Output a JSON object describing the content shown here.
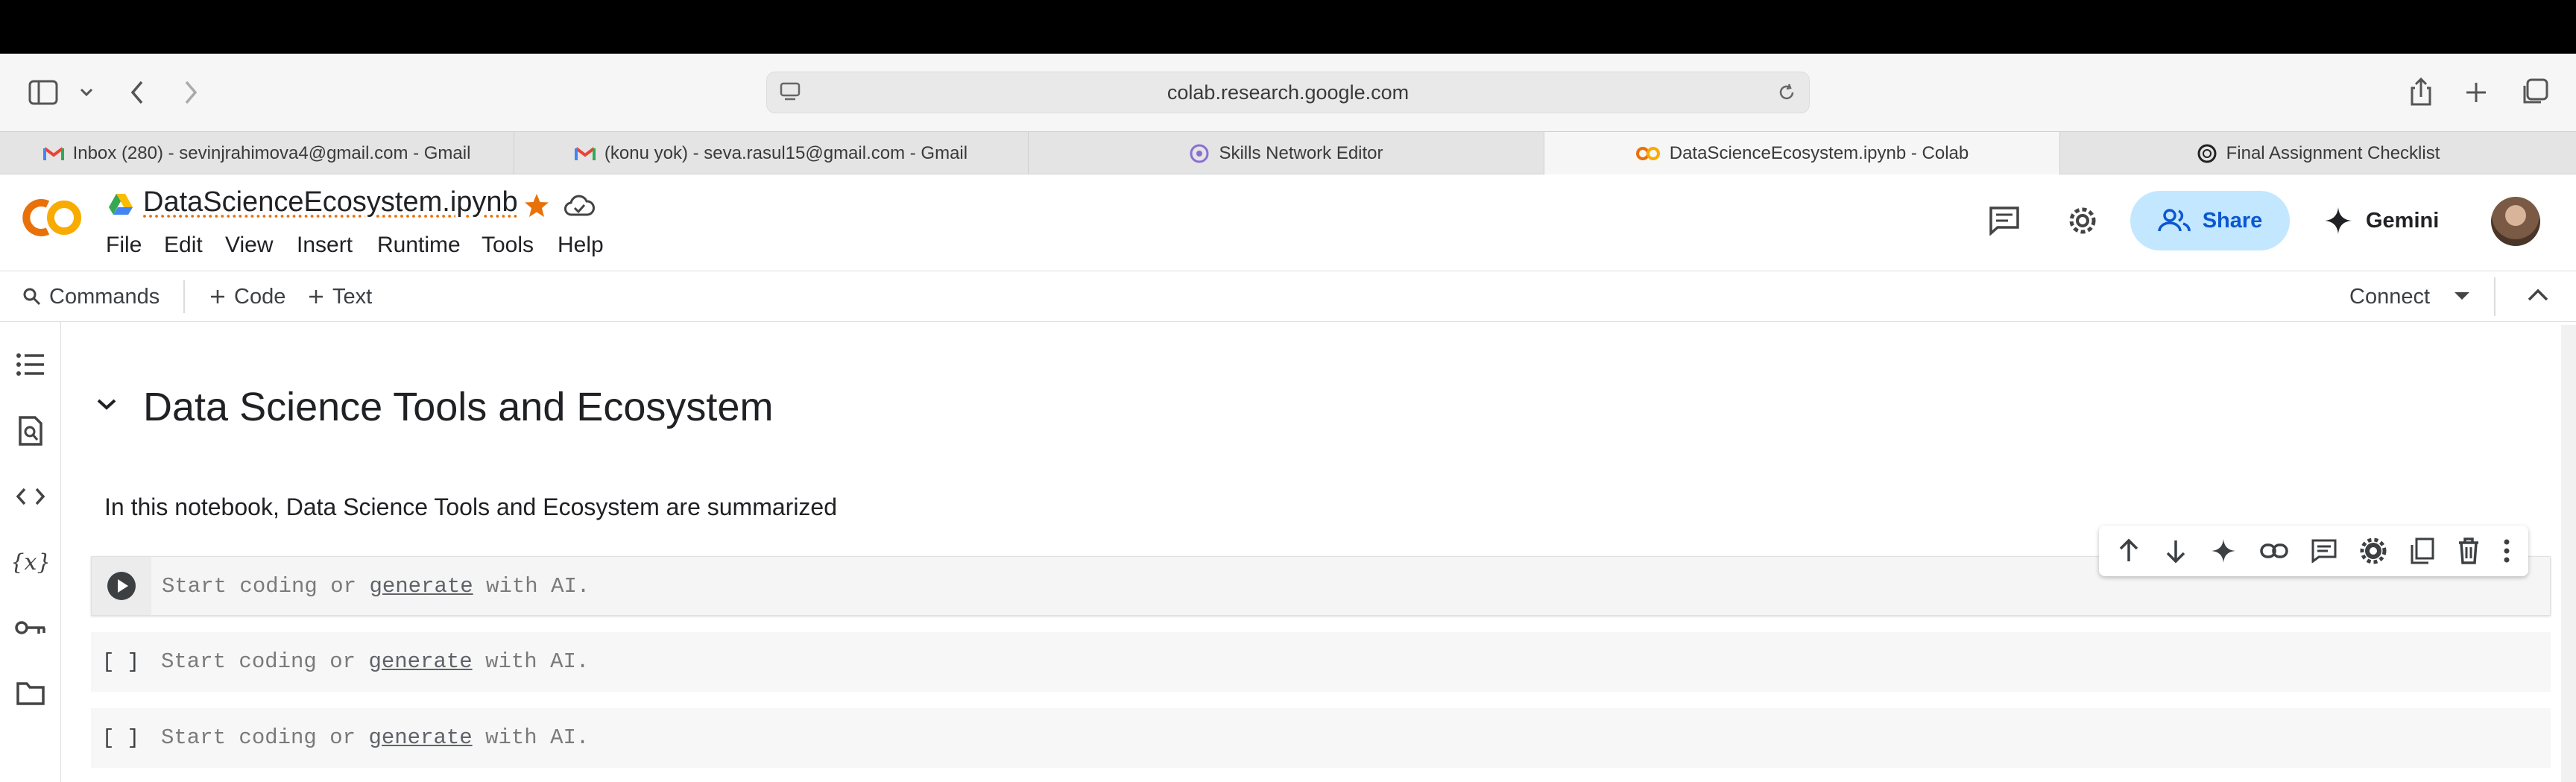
{
  "browser": {
    "url": "colab.research.google.com",
    "tabs": [
      {
        "label": "Inbox (280) - sevinjrahimova4@gmail.com - Gmail",
        "icon": "gmail-icon"
      },
      {
        "label": "(konu yok) - seva.rasul15@gmail.com - Gmail",
        "icon": "gmail-icon"
      },
      {
        "label": "Skills Network Editor",
        "icon": "skills-network-icon"
      },
      {
        "label": "DataScienceEcosystem.ipynb - Colab",
        "icon": "colab-icon",
        "active": true
      },
      {
        "label": "Final Assignment Checklist",
        "icon": "chatgpt-icon"
      }
    ]
  },
  "colab": {
    "logo_text": "CO",
    "notebook_title": "DataScienceEcosystem.ipynb",
    "menu": [
      "File",
      "Edit",
      "View",
      "Insert",
      "Runtime",
      "Tools",
      "Help"
    ],
    "share_label": "Share",
    "gemini_label": "Gemini",
    "toolbar": {
      "commands_label": "Commands",
      "code_label": "Code",
      "text_label": "Text",
      "connect_label": "Connect"
    },
    "accent_color": "#0b57d0",
    "share_bg_color": "#c2e7ff",
    "star_color": "#e8710a"
  },
  "notebook": {
    "heading": "Data Science Tools and Ecosystem",
    "description": "In this notebook, Data Science Tools and Ecosystem are summarized",
    "cells": [
      {
        "prompt": "",
        "placeholder_before": "Start coding or ",
        "placeholder_link": "generate",
        "placeholder_after": " with AI."
      },
      {
        "prompt": "[ ]",
        "placeholder_before": "Start coding or ",
        "placeholder_link": "generate",
        "placeholder_after": " with AI."
      },
      {
        "prompt": "[ ]",
        "placeholder_before": "Start coding or ",
        "placeholder_link": "generate",
        "placeholder_after": " with AI."
      }
    ]
  }
}
